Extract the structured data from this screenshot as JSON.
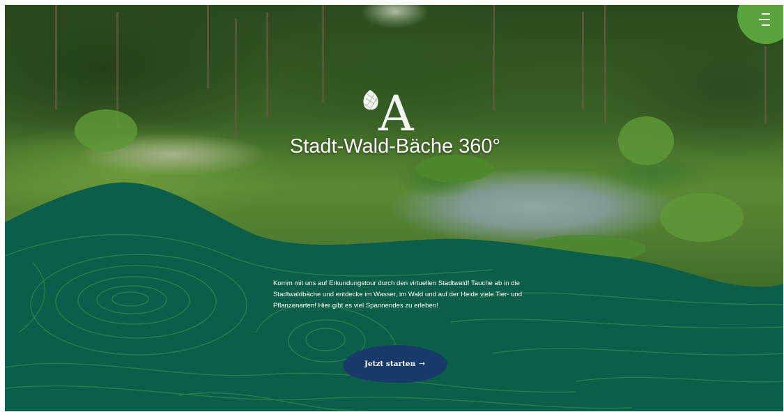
{
  "hero": {
    "title": "Stadt-Wald-Bäche 360°",
    "logo_icon": "pinecone-letter-a-logo"
  },
  "intro": {
    "text": "Komm mit uns auf Erkundungstour durch den virtuellen Stadtwald! Tauche ab in die Stadtwaldbäche und entdecke im Wasser, im Wald und auf der Heide viele Tier- und Pflanzenarten! Hier gibt es viel Spannendes zu erleben!"
  },
  "cta": {
    "label": "Jetzt starten",
    "arrow": "→"
  },
  "menu": {
    "icon": "hamburger-menu-icon"
  },
  "colors": {
    "wave_green": "#0a5e4a",
    "contour_line": "#2f8a4e",
    "button_blue": "#183a6b",
    "menu_green": "#5aa43d"
  }
}
